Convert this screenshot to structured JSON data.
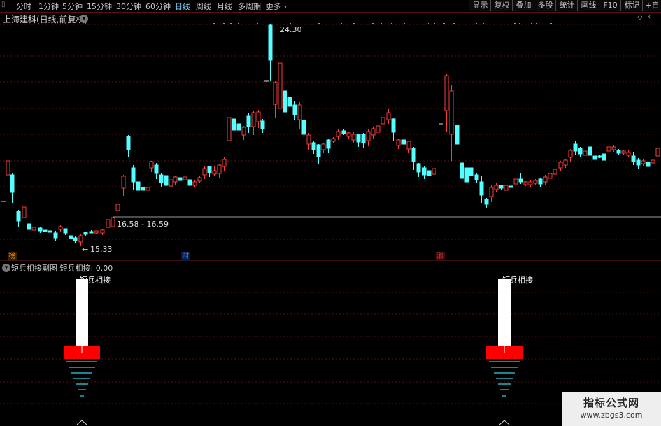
{
  "toolbar": {
    "periods": [
      "分时",
      "1分钟",
      "5分钟",
      "15分钟",
      "30分钟",
      "60分钟",
      "日线",
      "周线",
      "月线",
      "多周期",
      "更多"
    ],
    "more_arrow": "›",
    "active_period": "日线",
    "buttons": [
      "显示",
      "复权",
      "叠加",
      "多股",
      "统计",
      "画线",
      "F10",
      "标记",
      "+自选"
    ]
  },
  "header": {
    "title": "上海建科(日线,前复权)"
  },
  "main_chart": {
    "high_label": "24.30",
    "range_label": "16.58 - 16.59",
    "low_label": "15.33",
    "colors": {
      "up": "#ff3c3c",
      "down": "#54ffff",
      "grid": "#5a1010",
      "marker": "#ff4cff"
    }
  },
  "event_tags": [
    {
      "text": "榜",
      "color": "#ff8800"
    },
    {
      "text": "财",
      "color": "#3a78ff"
    },
    {
      "text": "涨",
      "color": "#ff3c3c"
    }
  ],
  "indicator": {
    "name": "短兵相接副图",
    "value_label": "短兵相接: 0.00",
    "signal_label": "短兵相接"
  },
  "watermark": {
    "cn": "指标公式网",
    "url": "www.zbgs3.com"
  }
}
